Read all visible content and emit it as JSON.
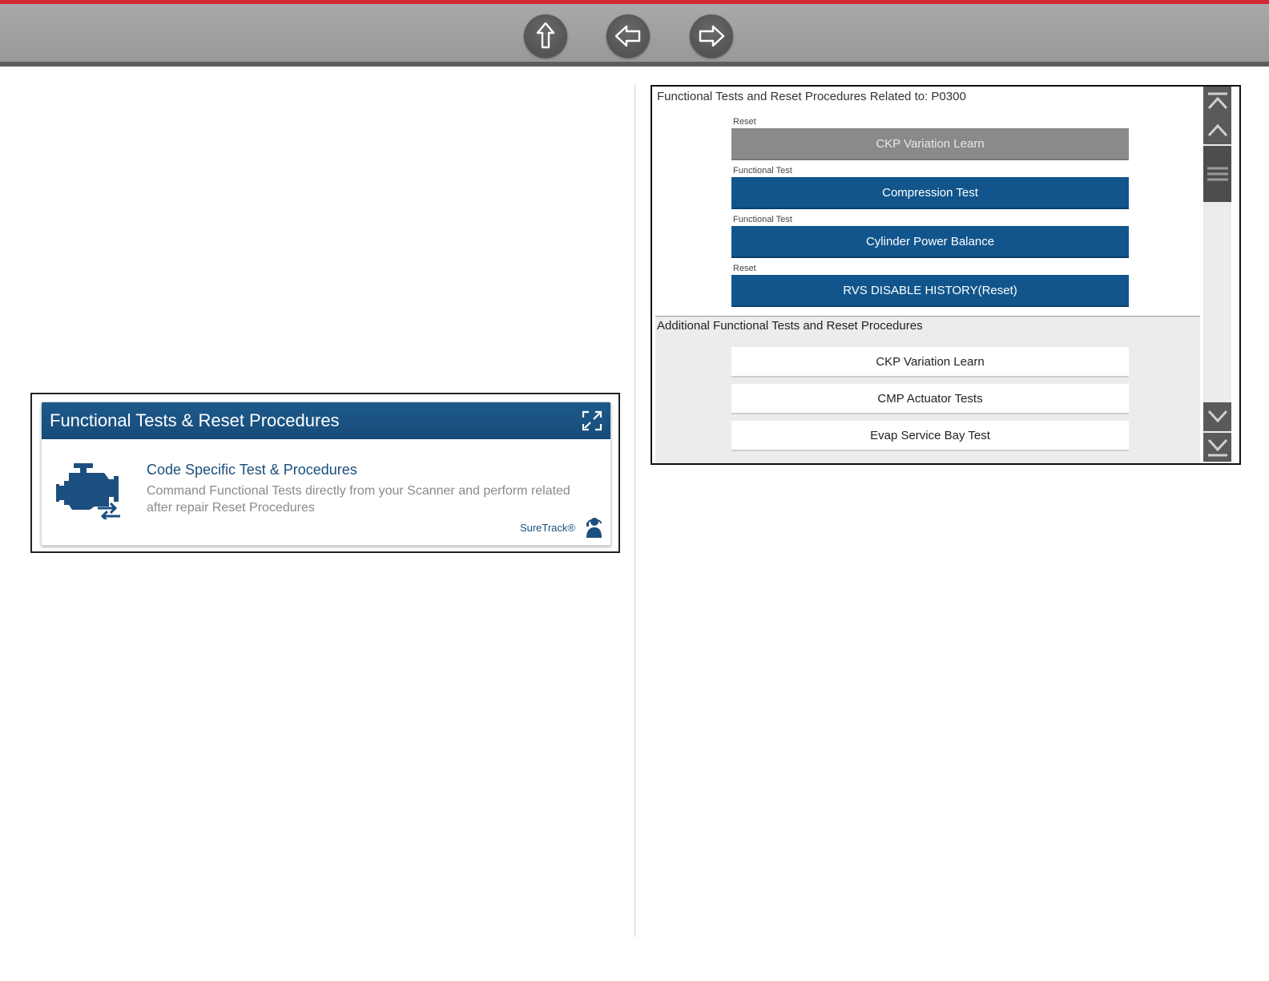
{
  "nav": {
    "home_icon": "up-arrow-icon",
    "back_icon": "left-arrow-icon",
    "forward_icon": "right-arrow-icon"
  },
  "card": {
    "header": "Functional Tests & Reset Procedures",
    "title": "Code Specific Test & Procedures",
    "description": "Command Functional Tests directly from your Scanner and perform related after repair Reset Procedures",
    "brand": "SureTrack®"
  },
  "screen": {
    "related_title": "Functional Tests and Reset Procedures Related to:  P0300",
    "procedures": [
      {
        "label": "Reset",
        "name": "CKP Variation Learn"
      },
      {
        "label": "Functional Test",
        "name": "Compression Test"
      },
      {
        "label": "Functional Test",
        "name": "Cylinder Power Balance"
      },
      {
        "label": "Reset",
        "name": "RVS DISABLE HISTORY(Reset)"
      }
    ],
    "additional_title": "Additional Functional Tests and Reset Procedures",
    "additional": [
      "CKP Variation Learn",
      "CMP Actuator Tests",
      "Evap Service Bay Test"
    ]
  },
  "colors": {
    "accent_red": "#d22630",
    "header_blue": "#174b78",
    "button_blue": "#11558c",
    "disabled_grey": "#8a8a8a"
  }
}
